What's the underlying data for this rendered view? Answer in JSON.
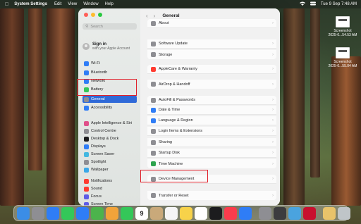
{
  "menubar": {
    "app_name": "System Settings",
    "menus": [
      "Edit",
      "View",
      "Window",
      "Help"
    ],
    "datetime": "Tue 9 Sep  7:48 AM"
  },
  "desktop": {
    "items": [
      {
        "line1": "Screenshot",
        "line2": "2025-0...54.53 AM"
      },
      {
        "line1": "Screenshot",
        "line2": "2025-0...55.04 AM"
      }
    ]
  },
  "sidebar": {
    "search_placeholder": "Search",
    "account_title": "Sign in",
    "account_subtitle": "with your Apple Account",
    "items": [
      {
        "label": "Wi-Fi",
        "icon": "wifi-icon",
        "color": "#2f7df6"
      },
      {
        "label": "Bluetooth",
        "icon": "bluetooth-icon",
        "color": "#2f7df6"
      },
      {
        "label": "Network",
        "icon": "network-icon",
        "color": "#2f7df6"
      },
      {
        "label": "Battery",
        "icon": "battery-icon",
        "color": "#34c759"
      },
      {
        "label": "General",
        "icon": "gear-icon",
        "color": "#8e8e93"
      },
      {
        "label": "Accessibility",
        "icon": "accessibility-icon",
        "color": "#2f7df6"
      },
      {
        "label": "Apple Intelligence & Siri",
        "icon": "siri-icon",
        "color": "#e0508a"
      },
      {
        "label": "Control Centre",
        "icon": "control-centre-icon",
        "color": "#8e8e93"
      },
      {
        "label": "Desktop & Dock",
        "icon": "dock-icon",
        "color": "#1c1c1e"
      },
      {
        "label": "Displays",
        "icon": "display-icon",
        "color": "#2f7df6"
      },
      {
        "label": "Screen Saver",
        "icon": "screen-saver-icon",
        "color": "#44b8e0"
      },
      {
        "label": "Spotlight",
        "icon": "spotlight-icon",
        "color": "#8e8e93"
      },
      {
        "label": "Wallpaper",
        "icon": "wallpaper-icon",
        "color": "#3aa8e8"
      },
      {
        "label": "Notifications",
        "icon": "notifications-icon",
        "color": "#ff3b30"
      },
      {
        "label": "Sound",
        "icon": "sound-icon",
        "color": "#ff3b30"
      },
      {
        "label": "Focus",
        "icon": "focus-icon",
        "color": "#5e5ce6"
      },
      {
        "label": "Screen Time",
        "icon": "screen-time-icon",
        "color": "#5e5ce6"
      }
    ]
  },
  "content": {
    "title": "General",
    "rows": [
      {
        "label": "About",
        "icon": "info-icon",
        "color": "#8e8e93"
      },
      {
        "label": "Software Update",
        "icon": "gear-icon",
        "color": "#8e8e93"
      },
      {
        "label": "Storage",
        "icon": "storage-icon",
        "color": "#8e8e93"
      },
      {
        "label": "AppleCare & Warranty",
        "icon": "apple-icon",
        "color": "#ff3b30"
      },
      {
        "label": "AirDrop & Handoff",
        "icon": "airdrop-icon",
        "color": "#8e8e93"
      },
      {
        "label": "AutoFill & Passwords",
        "icon": "autofill-icon",
        "color": "#8e8e93"
      },
      {
        "label": "Date & Time",
        "icon": "clock-icon",
        "color": "#2f7df6"
      },
      {
        "label": "Language & Region",
        "icon": "globe-icon",
        "color": "#2f7df6"
      },
      {
        "label": "Login Items & Extensions",
        "icon": "list-icon",
        "color": "#8e8e93"
      },
      {
        "label": "Sharing",
        "icon": "sharing-icon",
        "color": "#8e8e93"
      },
      {
        "label": "Startup Disk",
        "icon": "disk-icon",
        "color": "#8e8e93"
      },
      {
        "label": "Time Machine",
        "icon": "time-machine-icon",
        "color": "#2ea44f"
      },
      {
        "label": "Device Management",
        "icon": "device-management-icon",
        "color": "#8e8e93"
      },
      {
        "label": "Transfer or Reset",
        "icon": "reset-icon",
        "color": "#8e8e93"
      }
    ]
  },
  "dock": {
    "apps": [
      {
        "name": "finder-icon",
        "color": "#3b8de6"
      },
      {
        "name": "launchpad-icon",
        "color": "#8e8e93"
      },
      {
        "name": "safari-icon",
        "color": "#2f7df6"
      },
      {
        "name": "messages-icon",
        "color": "#34c759"
      },
      {
        "name": "mail-icon",
        "color": "#2f7df6"
      },
      {
        "name": "maps-icon",
        "color": "#4cb34c"
      },
      {
        "name": "photos-icon",
        "color": "#f2a33a"
      },
      {
        "name": "facetime-icon",
        "color": "#34c759"
      },
      {
        "name": "calendar-icon",
        "color": "#ffffff",
        "text": "9"
      },
      {
        "name": "contacts-icon",
        "color": "#c9a97a"
      },
      {
        "name": "reminders-icon",
        "color": "#f5f5f5"
      },
      {
        "name": "notes-icon",
        "color": "#f7d24a"
      },
      {
        "name": "freeform-icon",
        "color": "#ffffff"
      },
      {
        "name": "tv-icon",
        "color": "#1c1c1e"
      },
      {
        "name": "music-icon",
        "color": "#fa3c4c"
      },
      {
        "name": "app-store-icon",
        "color": "#2f7df6"
      },
      {
        "name": "system-settings-icon",
        "color": "#8e8e93"
      },
      {
        "name": "iphone-mirroring-icon",
        "color": "#3c3c3e"
      },
      {
        "name": "preview-icon",
        "color": "#4aa3df"
      },
      {
        "name": "vpn-icon",
        "color": "#c8102e"
      },
      {
        "name": "downloads-icon",
        "color": "#e8c36a"
      },
      {
        "name": "trash-icon",
        "color": "#bfc5c8"
      }
    ]
  },
  "highlight_color": "#e0202a"
}
